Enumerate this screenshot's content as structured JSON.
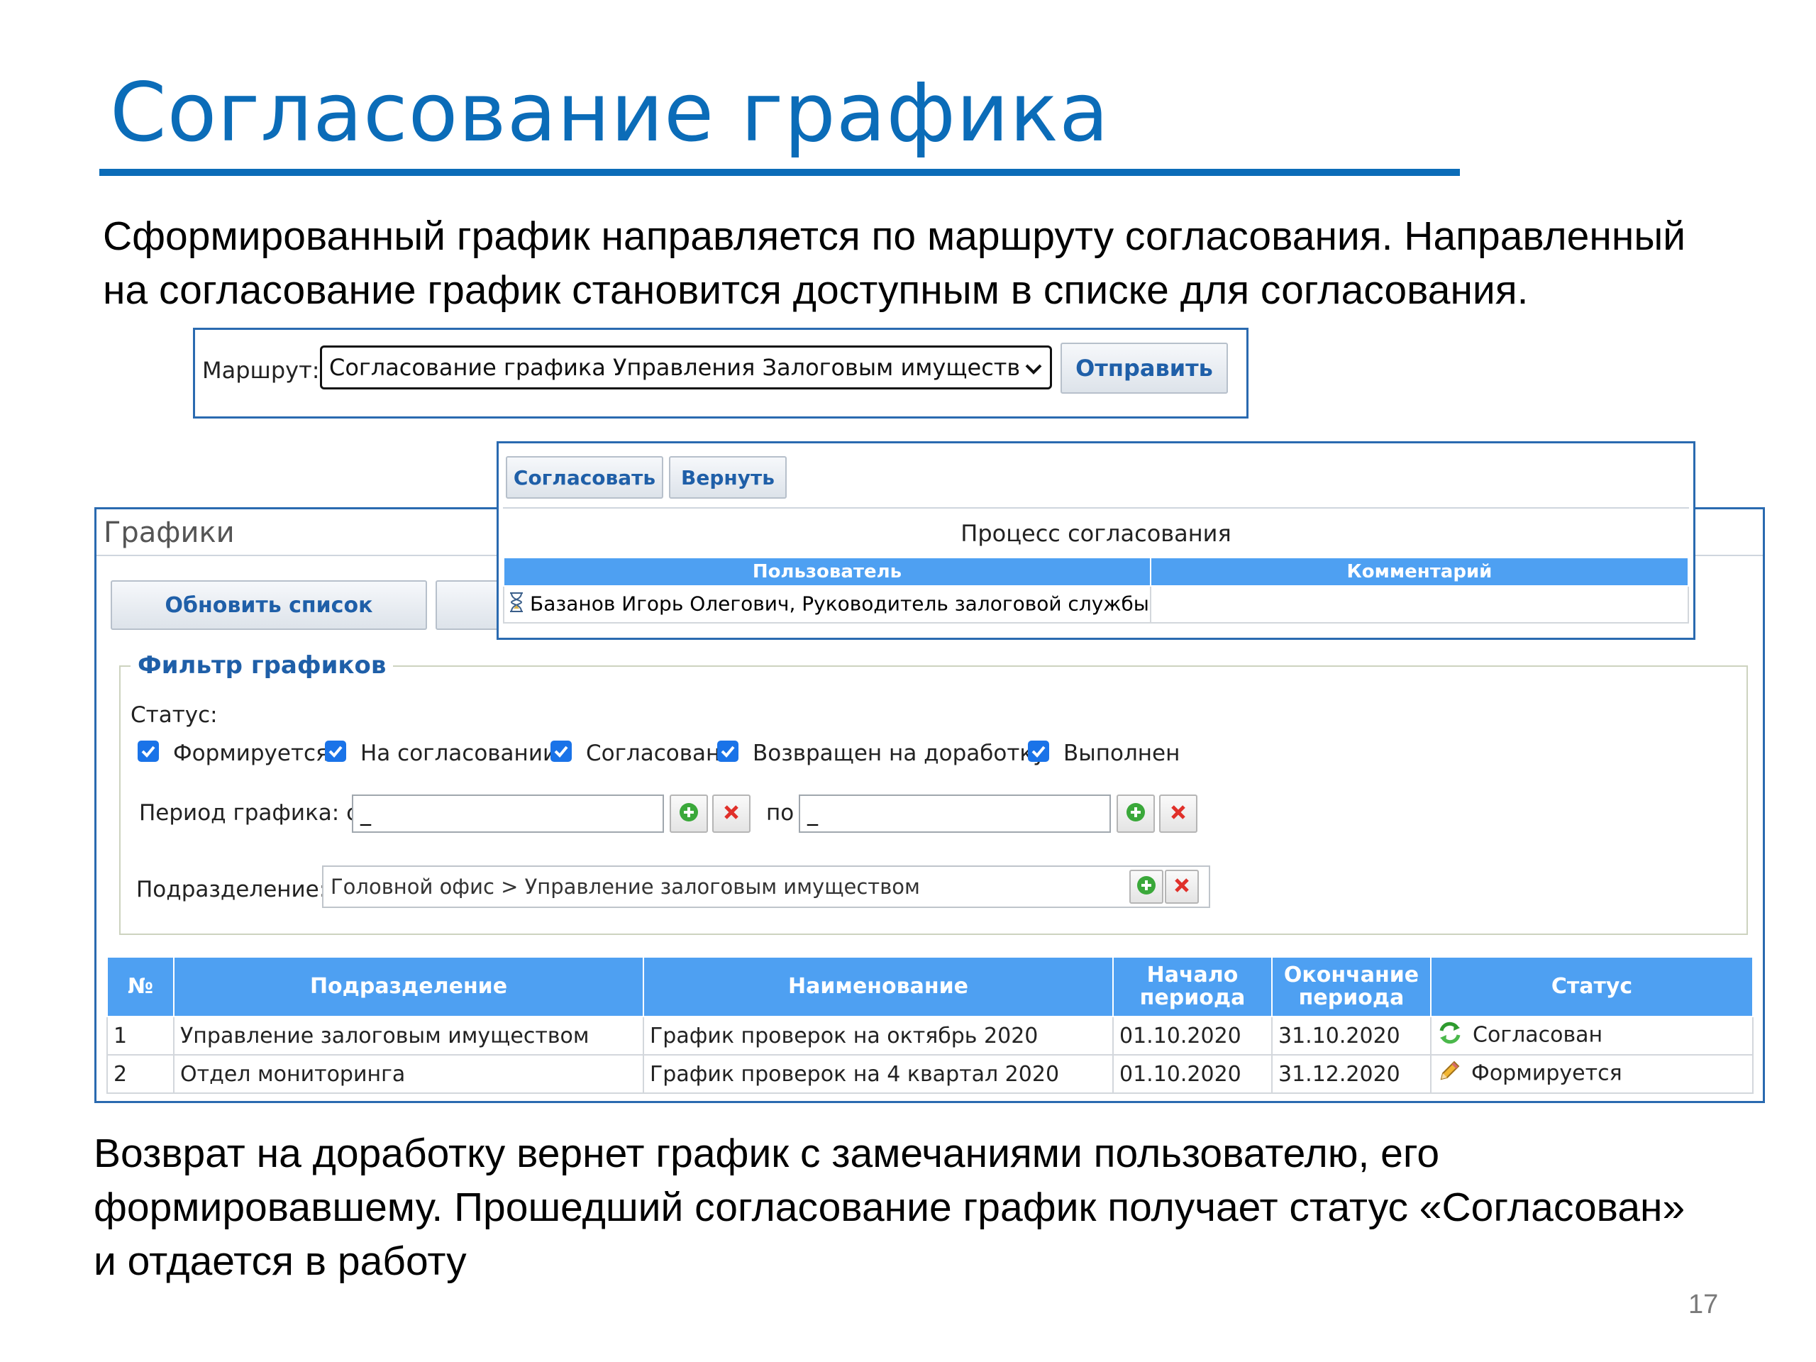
{
  "slide": {
    "title": "Согласование графика",
    "intro_line1": "Сформированный график направляется по маршруту согласования. Направленный",
    "intro_line2": "на согласование график становится доступным в списке для согласования.",
    "outro_line1": "Возврат на доработку вернет график с замечаниями пользователю, его",
    "outro_line2": "формировавшему. Прошедший согласование график получает статус «Согласован»",
    "outro_line3": "и отдается в работу",
    "page_number": "17",
    "accent_color": "#0b6cb8"
  },
  "route": {
    "label": "Маршрут:",
    "selected": "Согласование графика Управления Залоговым имуществом",
    "send_button": "Отправить"
  },
  "approval": {
    "approve_button": "Согласовать",
    "return_button": "Вернуть",
    "title": "Процесс согласования",
    "columns": [
      "Пользователь",
      "Комментарий"
    ],
    "rows": [
      {
        "icon": "hourglass-icon",
        "user": "Базанов Игорь Олегович, Руководитель залоговой службы",
        "comment": ""
      }
    ]
  },
  "grafiki": {
    "title": "Графики",
    "refresh_button": "Обновить список",
    "filter": {
      "legend": "Фильтр графиков",
      "status_label": "Статус:",
      "statuses": [
        {
          "label": "Формируется",
          "checked": true
        },
        {
          "label": "На согласовании",
          "checked": true
        },
        {
          "label": "Согласован",
          "checked": true
        },
        {
          "label": "Возвращен на доработку",
          "checked": true
        },
        {
          "label": "Выполнен",
          "checked": true
        }
      ],
      "period_label": "Период графика: с",
      "period_from": "_",
      "period_to_label": "по",
      "period_to": "_",
      "division_label": "Подразделение:",
      "division_value": "Головной офис > Управление залоговым имуществом"
    },
    "table": {
      "columns": [
        "№",
        "Подразделение",
        "Наименование",
        "Начало периода",
        "Окончание периода",
        "Статус"
      ],
      "rows": [
        {
          "num": "1",
          "division": "Управление залоговым имуществом",
          "name": "График проверок на октябрь 2020",
          "start": "01.10.2020",
          "end": "31.10.2020",
          "status_icon": "refresh-icon",
          "status": "Согласован"
        },
        {
          "num": "2",
          "division": "Отдел мониторинга",
          "name": "График проверок на 4 квартал 2020",
          "start": "01.10.2020",
          "end": "31.12.2020",
          "status_icon": "pencil-icon",
          "status": "Формируется"
        }
      ]
    }
  }
}
